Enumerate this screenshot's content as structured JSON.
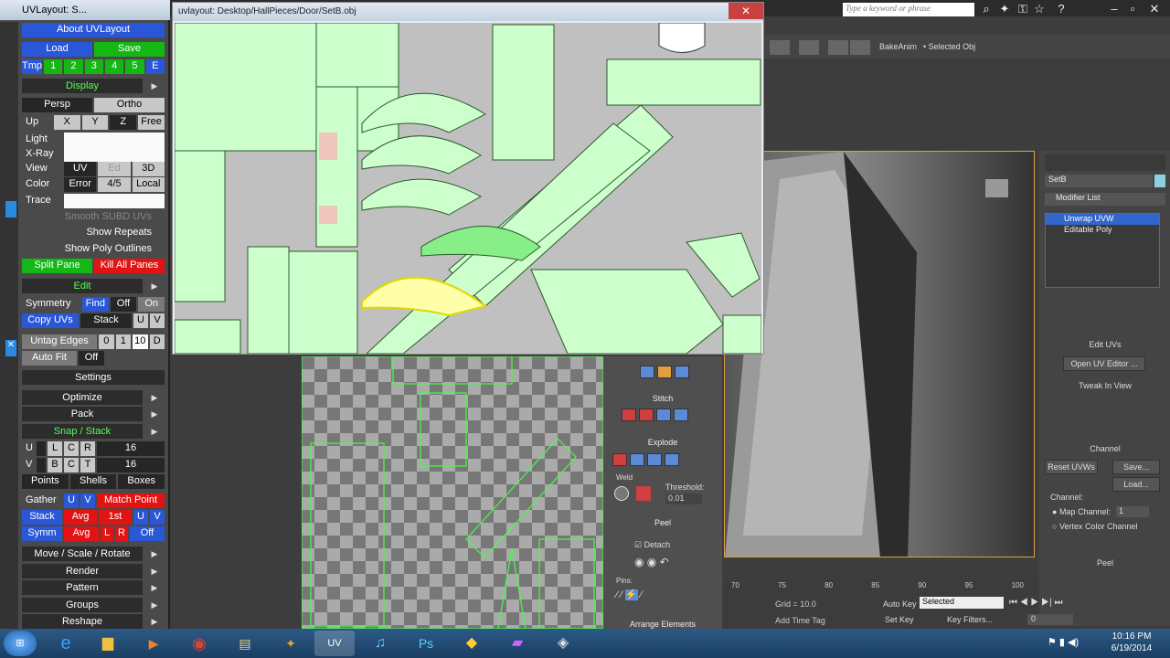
{
  "max": {
    "search_placeholder": "Type a keyword or phrase",
    "toolbar_labels": [
      "BakeAnim",
      "• Selected Obj"
    ],
    "command_panel": {
      "object_name": "SetB",
      "modifier_list": "Modifier List",
      "stack": [
        "Unwrap UVW",
        "Editable Poly"
      ],
      "edit_uvs_title": "Edit UVs",
      "open_uv_editor": "Open UV Editor ...",
      "tweak_in_view": "Tweak In View",
      "channel_title": "Channel",
      "reset_uvws": "Reset UVWs",
      "save": "Save...",
      "load": "Load...",
      "channel_label": "Channel:",
      "map_channel": "Map Channel:",
      "map_channel_value": "1",
      "vertex_color_channel": "Vertex Color Channel",
      "peel_title": "Peel"
    },
    "timeline": {
      "ticks": [
        "70",
        "75",
        "80",
        "85",
        "90",
        "95",
        "100"
      ],
      "grid": "Grid = 10.0",
      "add_time_tag": "Add Time Tag",
      "auto_key": "Auto Key",
      "set_key": "Set Key",
      "selected": "Selected",
      "key_filters": "Key Filters...",
      "frame": "0"
    }
  },
  "uvlayout": {
    "title": "UVLayout: S...",
    "about": "About UVLayout",
    "load": "Load",
    "save": "Save",
    "tmp": "Tmp",
    "tmp_nums": [
      "1",
      "2",
      "3",
      "4",
      "5",
      "E"
    ],
    "display": "Display",
    "persp": "Persp",
    "ortho": "Ortho",
    "up": "Up",
    "axes": [
      "X",
      "Y",
      "Z",
      "Free"
    ],
    "light": "Light",
    "xray": "X-Ray",
    "view": "View",
    "view_opts": [
      "UV",
      "Ed",
      "3D"
    ],
    "color": "Color",
    "color_opts": [
      "Error",
      "4/5",
      "Local"
    ],
    "trace": "Trace",
    "smooth": "Smooth SUBD UVs",
    "show_repeats": "Show Repeats",
    "show_poly": "Show Poly Outlines",
    "split_pane": "Split Pane",
    "kill_panes": "Kill All Panes",
    "edit": "Edit",
    "symmetry": "Symmetry",
    "find": "Find",
    "off": "Off",
    "on": "On",
    "copy_uvs": "Copy UVs",
    "stack": "Stack",
    "u": "U",
    "v": "V",
    "untag_edges": "Untag Edges",
    "untag_nums": [
      "0",
      "1",
      "10",
      "D"
    ],
    "auto_fit": "Auto Fit",
    "settings": "Settings",
    "optimize": "Optimize",
    "pack": "Pack",
    "snap_stack": "Snap / Stack",
    "snap_u": [
      "U",
      "L",
      "C",
      "R"
    ],
    "snap_v": [
      "V",
      "B",
      "C",
      "T"
    ],
    "snap_val": "16",
    "points": "Points",
    "shells": "Shells",
    "boxes": "Boxes",
    "gather": "Gather",
    "match_point": "Match Point",
    "avg": "Avg",
    "first": "1st",
    "symm": "Symm",
    "lr": [
      "L",
      "R"
    ],
    "move_scale": "Move / Scale / Rotate",
    "render": "Render",
    "pattern": "Pattern",
    "groups": "Groups",
    "reshape": "Reshape"
  },
  "uvwindow": {
    "title": "uvlayout: Desktop/HallPieces/Door/SetB.obj",
    "close": "✕"
  },
  "edituv": {
    "stitch": "Stitch",
    "explode": "Explode",
    "weld": "Weld",
    "threshold": "Threshold:",
    "threshold_value": "0.01",
    "peel": "Peel",
    "detach": "Detach",
    "pins": "Pins:",
    "arrange": "Arrange Elements"
  },
  "taskbar": {
    "time": "10:16 PM",
    "date": "6/19/2014",
    "apps": [
      "start-orb",
      "ie-icon",
      "explorer-icon",
      "media-icon",
      "chrome-icon",
      "folder-icon",
      "3dsmax-icon",
      "uvlayout-icon",
      "itunes-icon",
      "photoshop-icon",
      "app-icon",
      "purple-icon",
      "app2-icon"
    ]
  }
}
